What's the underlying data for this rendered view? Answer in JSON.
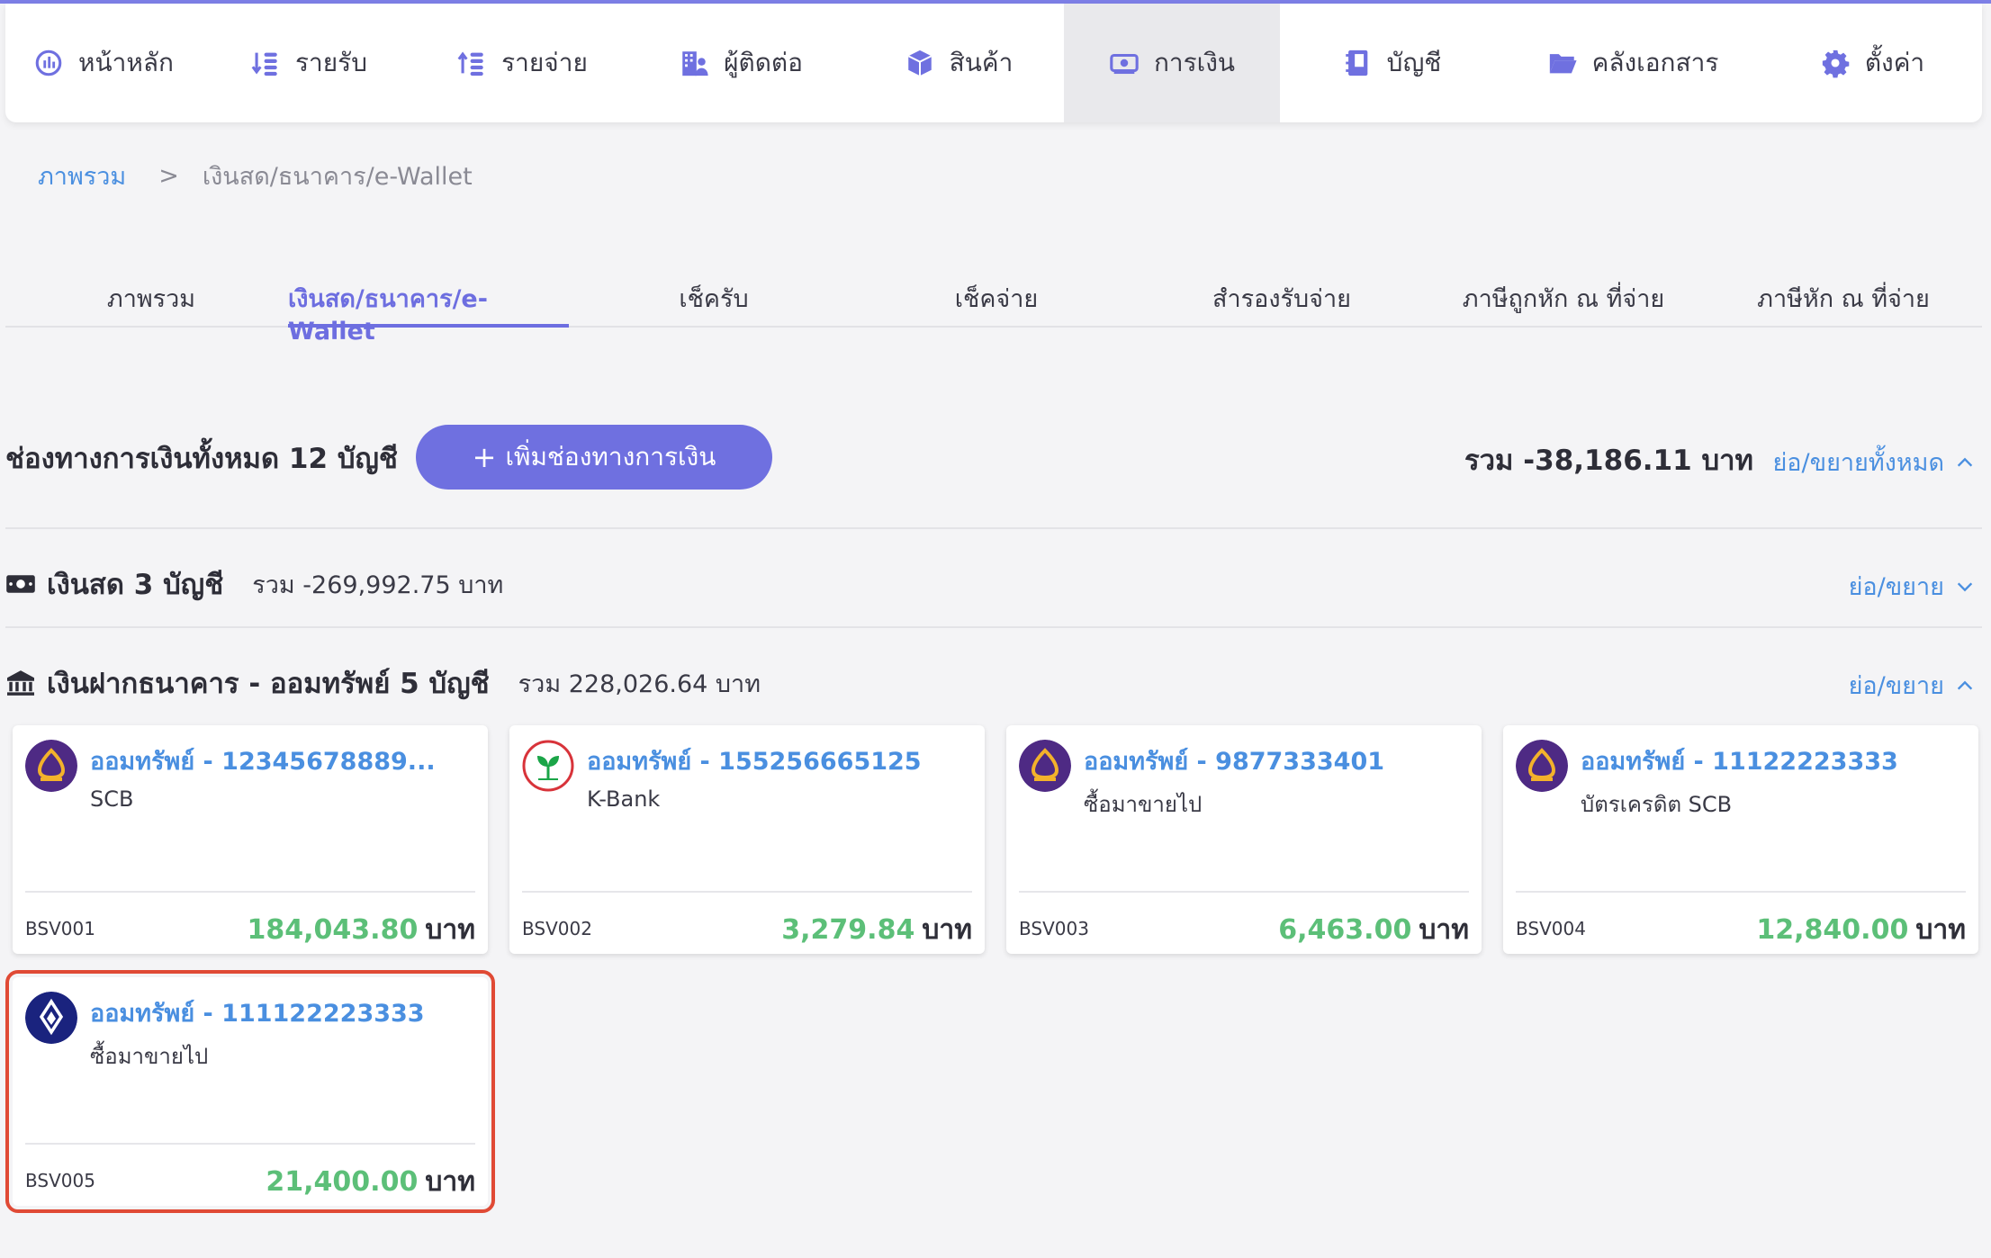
{
  "nav": {
    "items": [
      {
        "label": "หน้าหลัก",
        "icon": "dashboard-icon"
      },
      {
        "label": "รายรับ",
        "icon": "income-icon"
      },
      {
        "label": "รายจ่าย",
        "icon": "expense-icon"
      },
      {
        "label": "ผู้ติดต่อ",
        "icon": "contacts-icon"
      },
      {
        "label": "สินค้า",
        "icon": "box-icon"
      },
      {
        "label": "การเงิน",
        "icon": "money-icon",
        "active": true
      },
      {
        "label": "บัญชี",
        "icon": "ledger-icon"
      },
      {
        "label": "คลังเอกสาร",
        "icon": "folder-icon"
      },
      {
        "label": "ตั้งค่า",
        "icon": "gear-icon"
      }
    ]
  },
  "breadcrumb": {
    "root": "ภาพรวม",
    "separator": ">",
    "current": "เงินสด/ธนาคาร/e-Wallet"
  },
  "tabs": [
    {
      "label": "ภาพรวม"
    },
    {
      "label": "เงินสด/ธนาคาร/e-Wallet",
      "active": true
    },
    {
      "label": "เช็ครับ"
    },
    {
      "label": "เช็คจ่าย"
    },
    {
      "label": "สำรองรับจ่าย"
    },
    {
      "label": "ภาษีถูกหัก ณ ที่จ่าย"
    },
    {
      "label": "ภาษีหัก ณ ที่จ่าย"
    }
  ],
  "summary": {
    "title": "ช่องทางการเงินทั้งหมด 12 บัญชี",
    "add_button": "เพิ่มช่องทางการเงิน",
    "add_icon": "+",
    "total": "รวม -38,186.11 บาท",
    "toggle_all": "ย่อ/ขยายทั้งหมด"
  },
  "sections": {
    "cash": {
      "name": "เงินสด 3 บัญชี",
      "total": "รวม -269,992.75 บาท",
      "toggle": "ย่อ/ขยาย",
      "icon": "cash-icon"
    },
    "bank": {
      "name": "เงินฝากธนาคาร - ออมทรัพย์ 5 บัญชี",
      "total": "รวม 228,026.64 บาท",
      "toggle": "ย่อ/ขยาย",
      "icon": "bank-icon"
    }
  },
  "accounts": [
    {
      "title": "ออมทรัพย์ - 12345678889...",
      "bank": "SCB",
      "code": "BSV001",
      "amount": "184,043.80",
      "unit": "บาท",
      "logo": "scb-logo",
      "logo_color": "#4e2a84"
    },
    {
      "title": "ออมทรัพย์ - 155256665125",
      "bank": "K-Bank",
      "code": "BSV002",
      "amount": "3,279.84",
      "unit": "บาท",
      "logo": "kbank-logo",
      "logo_color": "#1ba548"
    },
    {
      "title": "ออมทรัพย์ - 9877333401",
      "bank": "ซื้อมาขายไป",
      "code": "BSV003",
      "amount": "6,463.00",
      "unit": "บาท",
      "logo": "scb-logo",
      "logo_color": "#4e2a84"
    },
    {
      "title": "ออมทรัพย์ - 11122223333",
      "bank": "บัตรเครดิต SCB",
      "code": "BSV004",
      "amount": "12,840.00",
      "unit": "บาท",
      "logo": "scb-logo",
      "logo_color": "#4e2a84"
    },
    {
      "title": "ออมทรัพย์ - 111122223333",
      "bank": "ซื้อมาขายไป",
      "code": "BSV005",
      "amount": "21,400.00",
      "unit": "บาท",
      "logo": "bbl-logo",
      "logo_color": "#1a237e",
      "highlighted": true
    }
  ],
  "colors": {
    "accent": "#6f70e0",
    "link": "#4a8fe0",
    "amount": "#5cbf78",
    "highlight": "#e04a35"
  }
}
